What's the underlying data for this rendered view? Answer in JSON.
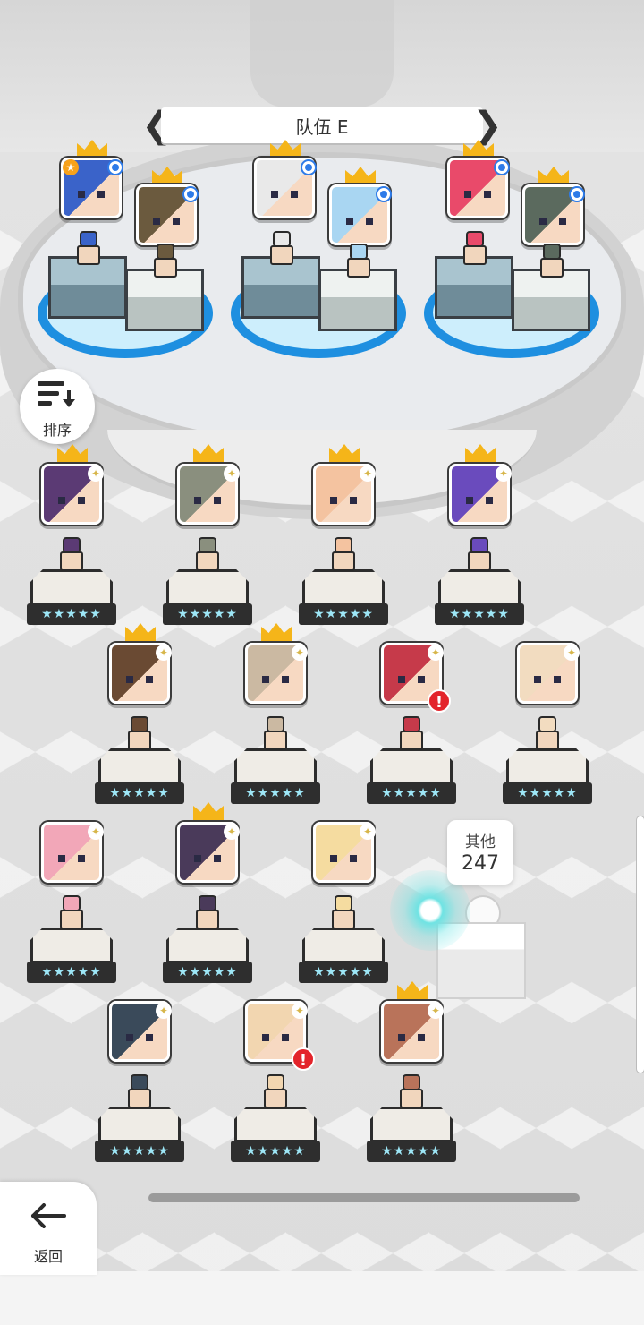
{
  "team": {
    "title": "队伍 E",
    "prev_arrow": "❮",
    "next_arrow": "❯"
  },
  "sort": {
    "label": "排序",
    "icon": "sort-icon"
  },
  "back": {
    "label": "返回",
    "icon": "back-arrow-icon"
  },
  "others": {
    "label": "其他",
    "count": "247"
  },
  "alert_symbol": "!",
  "stars_text": "★★★★★",
  "team_members": [
    {
      "crown": true,
      "badge": "star",
      "selected": true,
      "color": "#3a63c9"
    },
    {
      "crown": true,
      "badge": "none",
      "selected": true,
      "color": "#6b5a3e"
    },
    {
      "crown": true,
      "badge": "none",
      "selected": true,
      "color": "#e9e9e9"
    },
    {
      "crown": true,
      "badge": "none",
      "selected": true,
      "color": "#a9d6f2"
    },
    {
      "crown": true,
      "badge": "none",
      "selected": true,
      "color": "#e94a6a"
    },
    {
      "crown": true,
      "badge": "none",
      "selected": true,
      "color": "#5b6a5e"
    }
  ],
  "roster": [
    {
      "crown": true,
      "alert": false,
      "color": "#5b3a74"
    },
    {
      "crown": true,
      "alert": false,
      "color": "#8a8f7e"
    },
    {
      "crown": true,
      "alert": false,
      "color": "#f4c3a0"
    },
    {
      "crown": true,
      "alert": false,
      "color": "#6a4bbd"
    },
    {
      "crown": true,
      "alert": false,
      "color": "#6a4a33"
    },
    {
      "crown": true,
      "alert": false,
      "color": "#cbb9a2"
    },
    {
      "crown": false,
      "alert": true,
      "color": "#c63a4a"
    },
    {
      "crown": false,
      "alert": false,
      "color": "#f2dcc0"
    },
    {
      "crown": false,
      "alert": false,
      "color": "#f2a7b8"
    },
    {
      "crown": true,
      "alert": false,
      "color": "#4a3a5a"
    },
    {
      "crown": false,
      "alert": false,
      "color": "#f5dca0"
    },
    {
      "crown": false,
      "alert": false,
      "color": "#3a4a5a"
    },
    {
      "crown": false,
      "alert": true,
      "color": "#f2d6b0"
    },
    {
      "crown": true,
      "alert": false,
      "color": "#b9735a"
    }
  ]
}
